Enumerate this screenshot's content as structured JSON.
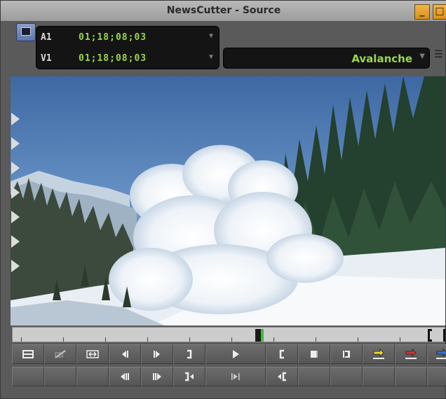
{
  "window": {
    "title": "NewsCutter - Source",
    "minimize_label": "_",
    "maximize_label": "□"
  },
  "timecode": {
    "rows": [
      {
        "track": "A1",
        "value": "01;18;08;03"
      },
      {
        "track": "V1",
        "value": "01;18;08;03"
      }
    ]
  },
  "clip": {
    "name": "Avalanche"
  },
  "glyphs": {
    "dropdown": "▼",
    "clip_menu": "☰"
  },
  "colors": {
    "timecode_green": "#9ad64a",
    "playhead_green": "#35c435",
    "mark_yellow": "#e8d830",
    "mark_red": "#d83030",
    "mark_blue": "#3070e0"
  },
  "controls": {
    "row1": [
      "make-subclip-icon",
      "mark-clip-icon",
      "fit-to-window-icon",
      "step-back-one-frame-icon",
      "step-forward-one-frame-icon",
      "mark-out-icon",
      "play-icon",
      "mark-in-icon",
      "go-to-in-icon",
      "go-to-out-icon",
      "splice-in-icon",
      "overwrite-icon",
      "lift-icon"
    ],
    "row2": [
      "empty",
      "empty",
      "empty",
      "step-back-ten-frames-icon",
      "step-forward-ten-frames-icon",
      "go-to-out-point-icon",
      "play-in-to-out-icon",
      "go-to-mark-in-icon",
      "empty",
      "empty",
      "empty",
      "empty",
      "empty"
    ]
  }
}
